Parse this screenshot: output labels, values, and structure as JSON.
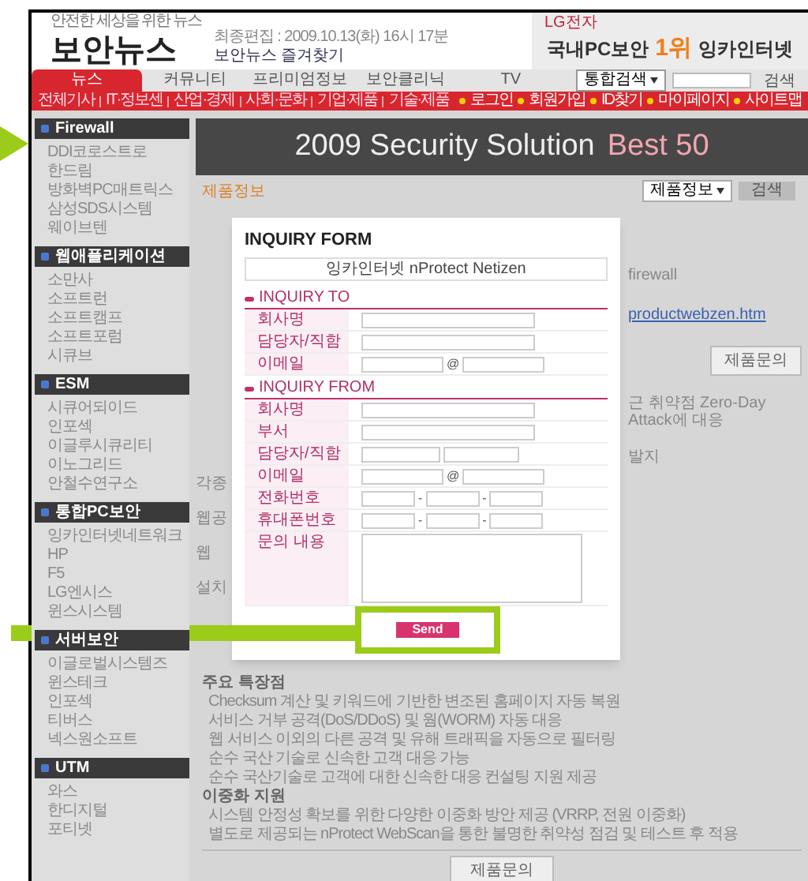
{
  "header": {
    "tagline": "안전한 세상을 위한 뉴스",
    "logo": "보안뉴스",
    "dateline": "최종편집 : 2009.10.13(화) 16시 17분",
    "bookmark": "보안뉴스 즐겨찾기",
    "ad": {
      "brand": "LG전자",
      "text_before": "국내PC보안",
      "rank": "1위",
      "text_after": "잉카인터넷"
    }
  },
  "nav": {
    "tabs": [
      {
        "label": "뉴스",
        "selected": true
      },
      {
        "label": "커뮤니티",
        "selected": false
      },
      {
        "label": "프리미엄정보",
        "selected": false
      },
      {
        "label": "보안클리닉",
        "selected": false
      },
      {
        "label": "TV",
        "selected": false
      }
    ],
    "search": {
      "scope": "통합검색",
      "button": "검색"
    }
  },
  "subnav": {
    "left": [
      "전체기사",
      "IT·정보센",
      "산업·경제",
      "사회·문화",
      "기업·제품",
      "기술·제품"
    ],
    "right": [
      "로그인",
      "회원가입",
      "ID찾기",
      "마이페이지",
      "사이트맵"
    ]
  },
  "sidebar": [
    {
      "title": "Firewall",
      "items": [
        "DDI코로스트로",
        "한드림",
        "방화벽PC매트릭스",
        "삼성SDS시스템",
        "웨이브텐"
      ]
    },
    {
      "title": "웹애플리케이션",
      "items": [
        "소만사",
        "소프트런",
        "소프트캠프",
        "소프트포럼",
        "시큐브"
      ]
    },
    {
      "title": "ESM",
      "items": [
        "시큐어되이드",
        "인포섹",
        "이글루시큐리티",
        "이노그리드",
        "안철수연구소"
      ]
    },
    {
      "title": "통합PC보안",
      "items": [
        "잉카인터넷네트워크",
        "HP",
        "F5",
        "LG엔시스",
        "윈스시스템"
      ]
    },
    {
      "title": "서버보안",
      "items": [
        "이글로벌시스템즈",
        "윈스테크",
        "인포섹",
        "티버스",
        "넥스원소프트"
      ]
    },
    {
      "title": "UTM",
      "items": [
        "와스",
        "한디지털",
        "포티넷"
      ]
    }
  ],
  "banner": {
    "text": "2009 Security Solution",
    "highlight": "Best 50"
  },
  "toolbar": {
    "breadcrumb": "제품정보",
    "select": "제품정보",
    "button": "검색"
  },
  "background": {
    "left_fragments": [
      "각종",
      "웹공",
      "웹",
      "설치"
    ],
    "right_fragments": [
      {
        "kind": "text",
        "text": "firewall"
      },
      {
        "kind": "link",
        "text": "productwebzen.htm"
      },
      {
        "kind": "button",
        "text": "제품문의"
      },
      {
        "kind": "text",
        "text": "근 취약점 Zero-Day Attack에 대응"
      },
      {
        "kind": "text",
        "text": "발지"
      }
    ],
    "sections": [
      {
        "title": "주요 특장점",
        "items": [
          "Checksum 계산 및 키워드에 기반한 변조된 홈페이지 자동 복원",
          "서비스 거부 공격(DoS/DDoS) 및 웜(WORM) 자동 대응",
          "웹 서비스 이외의 다른 공격 및 유해 트래픽을 자동으로 필터링",
          "순수 국산 기술로 신속한 고객 대응 가능",
          "순수 국산기술로 고객에 대한 신속한 대응 컨설팅 지원 제공"
        ]
      },
      {
        "title": "이중화 지원",
        "items": [
          "시스템 안정성 확보를 위한 다양한 이중화 방안 제공 (VRRP, 전원 이중화)",
          "별도로 제공되는 nProtect WebScan을 통한 불명한 취약성 점검 및 테스트 후 적용"
        ]
      }
    ],
    "button": "제품문의"
  },
  "modal": {
    "title": "INQUIRY FORM",
    "product": "잉카인터넷 nProtect Netizen",
    "sections": [
      {
        "heading": "INQUIRY TO",
        "fields": [
          {
            "label": "회사명",
            "kind": "text"
          },
          {
            "label": "담당자/직함",
            "kind": "text"
          },
          {
            "label": "이메일",
            "kind": "email",
            "separator": "@"
          }
        ]
      },
      {
        "heading": "INQUIRY FROM",
        "fields": [
          {
            "label": "회사명",
            "kind": "text"
          },
          {
            "label": "부서",
            "kind": "text"
          },
          {
            "label": "담당자/직함",
            "kind": "split"
          },
          {
            "label": "이메일",
            "kind": "email",
            "separator": "@"
          },
          {
            "label": "전화번호",
            "kind": "phone",
            "separator": "-"
          },
          {
            "label": "휴대폰번호",
            "kind": "phone",
            "separator": "-"
          },
          {
            "label": "문의 내용",
            "kind": "textarea"
          }
        ]
      }
    ],
    "send": "Send"
  }
}
